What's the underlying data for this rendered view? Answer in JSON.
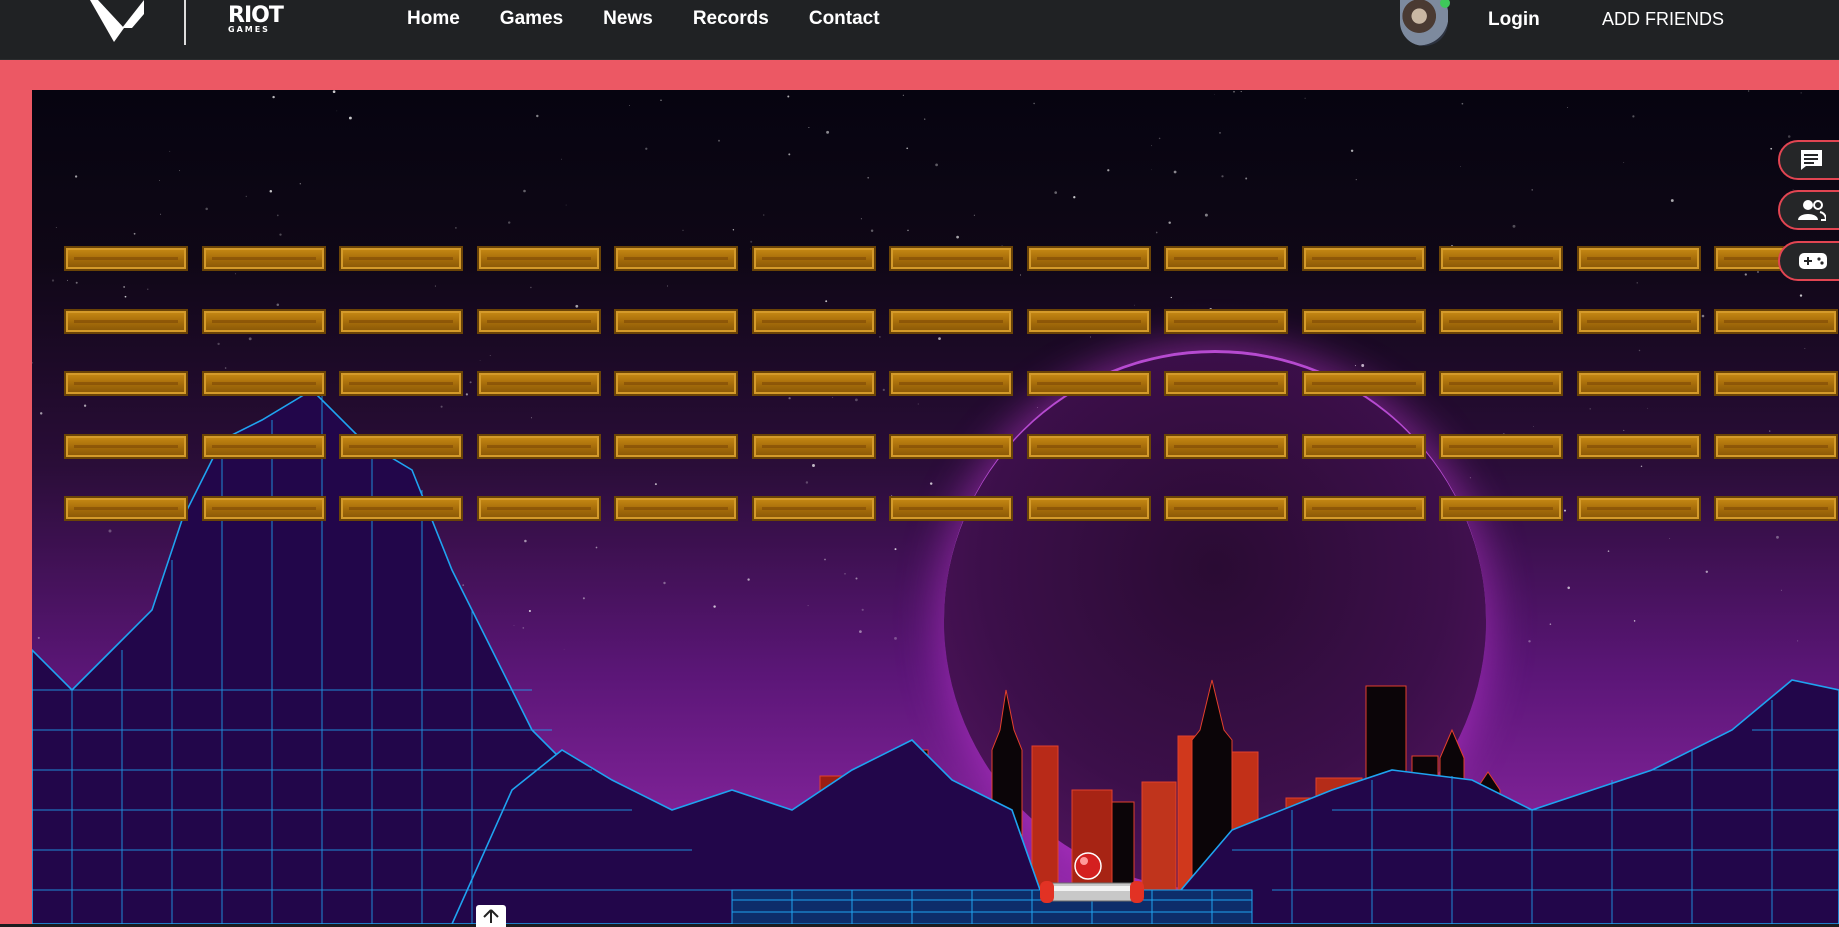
{
  "nav": {
    "brand_riot_big": "RIOT",
    "brand_riot_small": "GAMES",
    "links": [
      "Home",
      "Games",
      "News",
      "Records",
      "Contact"
    ],
    "login": "Login",
    "add_friends": "ADD FRIENDS"
  },
  "sidebar": {
    "buttons": [
      "chat-icon",
      "friends-icon",
      "gamepad-icon"
    ]
  },
  "game": {
    "title": "",
    "brick_rows": 5,
    "bricks_per_row": 13,
    "brick_color": "#b67a10",
    "frame_color": "#ec5864",
    "sun_glow_color": "#b64ad0",
    "grid_color": "#1fa3f0",
    "paddle_end_color": "#e23224",
    "ball_color": "#d42020"
  },
  "colors": {
    "navbar_bg": "#202224",
    "accent": "#e24552"
  }
}
